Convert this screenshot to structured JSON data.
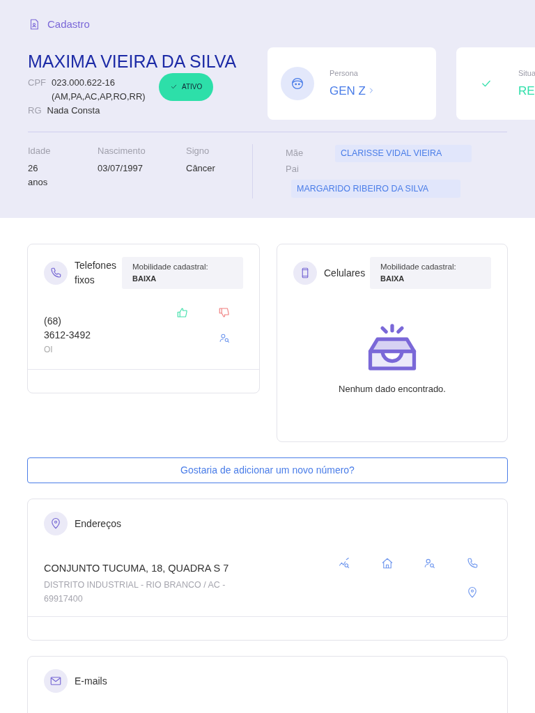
{
  "breadcrumb": "Cadastro",
  "person": {
    "name": "MAXIMA VIEIRA DA SILVA",
    "fields": [
      {
        "label": "CPF",
        "value": "023.000.622-16 (AM,PA,AC,AP,RO,RR)"
      },
      {
        "label": "RG",
        "value": "Nada Consta"
      }
    ],
    "status_badge": {
      "label": "ATIVO",
      "active": true
    }
  },
  "summary_cards": [
    {
      "kind": "persona",
      "label": "Persona",
      "value": "GEN Z"
    },
    {
      "kind": "status",
      "label": "Situa",
      "value": "RE"
    }
  ],
  "details": [
    {
      "label": "Idade",
      "value": "26 anos"
    },
    {
      "label": "Nascimento",
      "value": "03/07/1997"
    },
    {
      "label": "Signo",
      "value": "Câncer"
    }
  ],
  "parents": [
    {
      "label": "Mãe",
      "value": "CLARISSE VIDAL VIEIRA"
    },
    {
      "label": "Pai",
      "value": "MARGARIDO RIBEIRO DA SILVA"
    }
  ],
  "phone_sections": [
    {
      "kind": "landline",
      "title": "Telefones fixos",
      "mobility_label": "Mobilidade cadastral:",
      "mobility_value": "BAIXA",
      "numbers": [
        {
          "number": "(68) 3612-3492",
          "carrier": "OI"
        }
      ]
    },
    {
      "kind": "mobile",
      "title": "Celulares",
      "mobility_label": "Mobilidade cadastral:",
      "mobility_value": "BAIXA",
      "empty_message": "Nenhum dado encontrado."
    }
  ],
  "add_number_button": "Gostaria de adicionar um novo número?",
  "addresses": {
    "title": "Endereços",
    "items": [
      {
        "line1": "CONJUNTO TUCUMA, 18, QUADRA S 7",
        "line2": "DISTRITO INDUSTRIAL - RIO BRANCO / AC - 69917400"
      }
    ]
  },
  "emails": {
    "title": "E-mails"
  }
}
